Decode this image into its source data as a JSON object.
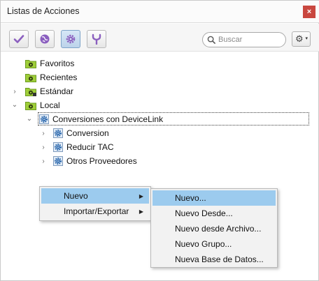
{
  "window": {
    "title": "Listas de Acciones",
    "close_label": "×"
  },
  "toolbar": {
    "buttons": [
      {
        "name": "check-icon",
        "color": "#8b5fbf"
      },
      {
        "name": "globe-icon",
        "color": "#8b5fbf"
      },
      {
        "name": "gear-icon",
        "color": "#8b5fbf",
        "active": true
      },
      {
        "name": "merge-icon",
        "color": "#8b5fbf"
      }
    ],
    "search_placeholder": "Buscar",
    "gear_menu_icon": "⚙",
    "gear_menu_caret": "▾"
  },
  "tree": {
    "items": [
      {
        "label": "Favoritos",
        "icon": "folder-gear-icon"
      },
      {
        "label": "Recientes",
        "icon": "folder-gear-icon"
      },
      {
        "label": "Estándar",
        "icon": "folder-gear-lock-icon",
        "twisty": "›"
      },
      {
        "label": "Local",
        "icon": "folder-gear-icon",
        "twisty": "⌄"
      },
      {
        "label": "Conversiones con DeviceLink",
        "icon": "gear-icon",
        "twisty": "⌄",
        "selected": true
      },
      {
        "label": "Conversion",
        "icon": "gear-icon",
        "twisty": "›"
      },
      {
        "label": "Reducir TAC",
        "icon": "gear-icon",
        "twisty": "›"
      },
      {
        "label": "Otros Proveedores",
        "icon": "gear-icon",
        "twisty": "›"
      }
    ]
  },
  "context_menu": {
    "items": [
      {
        "label": "Nuevo",
        "arrow": "▶",
        "highlighted": true
      },
      {
        "label": "Importar/Exportar",
        "arrow": "▶"
      }
    ]
  },
  "submenu": {
    "items": [
      {
        "label": "Nuevo...",
        "highlighted": true
      },
      {
        "label": "Nuevo Desde..."
      },
      {
        "label": "Nuevo desde Archivo..."
      },
      {
        "label": "Nuevo Grupo..."
      },
      {
        "label": "Nueva Base de Datos..."
      }
    ]
  },
  "colors": {
    "folder": "#9fce3a",
    "folder_dark": "#6c9a1e",
    "gear": "#1f5fa8",
    "accent": "#9ccbee"
  }
}
